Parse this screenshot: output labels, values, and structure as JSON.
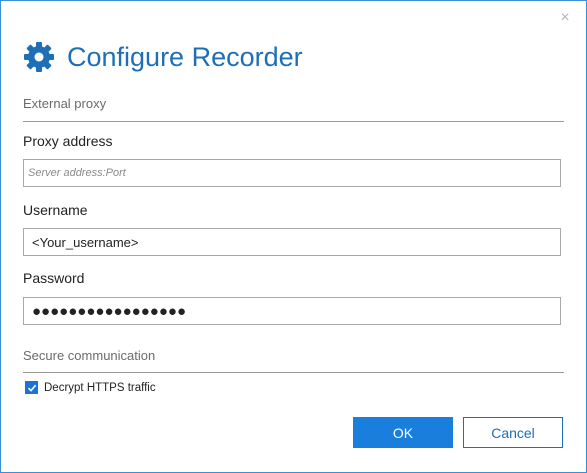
{
  "dialog": {
    "title": "Configure Recorder",
    "close_label": "×"
  },
  "external_proxy": {
    "section_label": "External proxy",
    "proxy_address_label": "Proxy address",
    "proxy_address_placeholder": "Server address:Port",
    "proxy_address_value": "",
    "username_label": "Username",
    "username_value": "<Your_username>",
    "password_label": "Password",
    "password_masked": "●●●●●●●●●●●●●●●●●"
  },
  "secure_communication": {
    "section_label": "Secure communication",
    "decrypt_https_label": "Decrypt HTTPS traffic",
    "decrypt_https_checked": true
  },
  "buttons": {
    "ok_label": "OK",
    "cancel_label": "Cancel"
  },
  "colors": {
    "accent": "#1a7fdc",
    "title": "#1f6fb8",
    "border": "#3a8fd9"
  },
  "icons": {
    "title_icon": "gear-icon",
    "close_icon": "close-icon",
    "check_icon": "checkmark-icon"
  }
}
